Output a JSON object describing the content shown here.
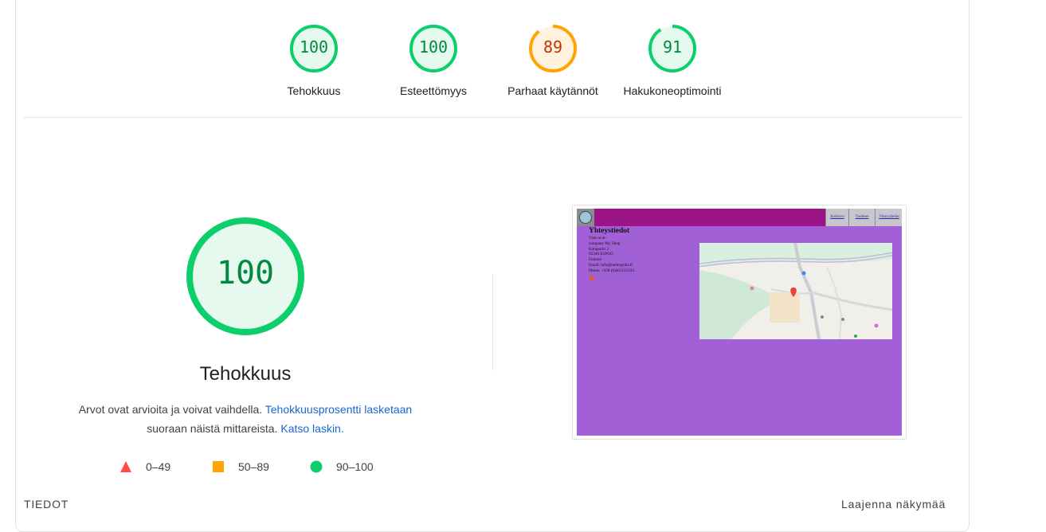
{
  "summary": {
    "gauges": [
      {
        "score": "100",
        "label": "Tehokkuus",
        "status": "pass",
        "fraction": 1.0
      },
      {
        "score": "100",
        "label": "Esteettömyys",
        "status": "pass",
        "fraction": 1.0
      },
      {
        "score": "89",
        "label": "Parhaat käytännöt",
        "status": "average",
        "fraction": 0.89
      },
      {
        "score": "91",
        "label": "Hakukoneoptimointi",
        "status": "pass",
        "fraction": 0.91
      }
    ]
  },
  "colors": {
    "pass": "#0cce6b",
    "pass_text": "#008a3e",
    "pass_fill": "#e6f9ee",
    "average": "#ffa400",
    "average_text": "#c33300",
    "average_fill": "#fff3e0",
    "fail": "#ff4e42",
    "link": "#1967d2"
  },
  "performance": {
    "score": "100",
    "fraction": 1.0,
    "title": "Tehokkuus",
    "desc_plain_1": "Arvot ovat arvioita ja voivat vaihdella.",
    "desc_link_1": "Tehokkuusprosentti lasketaan",
    "desc_plain_2": "suoraan näistä mittareista.",
    "desc_link_2": "Katso laskin."
  },
  "legend": [
    {
      "icon": "red-triangle-icon",
      "label": "0–49"
    },
    {
      "icon": "orange-square-icon",
      "label": "50–89"
    },
    {
      "icon": "green-circle-icon",
      "label": "90–100"
    }
  ],
  "screenshot": {
    "nav": [
      "Kotisivu",
      "Tuotteet",
      "Yhteystiedot"
    ],
    "heading": "Yhteystiedot",
    "address_lines": [
      "Visit us at:",
      "company My Shop",
      "Karaportti 2",
      "02340 ESPOO",
      "Finland",
      "Email: info@metropolia.fi",
      "Phone: +358 (0)401231233"
    ],
    "page_color": "#a260d6",
    "header_color": "#9b1488"
  },
  "footer": {
    "details_label": "TIEDOT",
    "expand_label": "Laajenna näkymää"
  }
}
